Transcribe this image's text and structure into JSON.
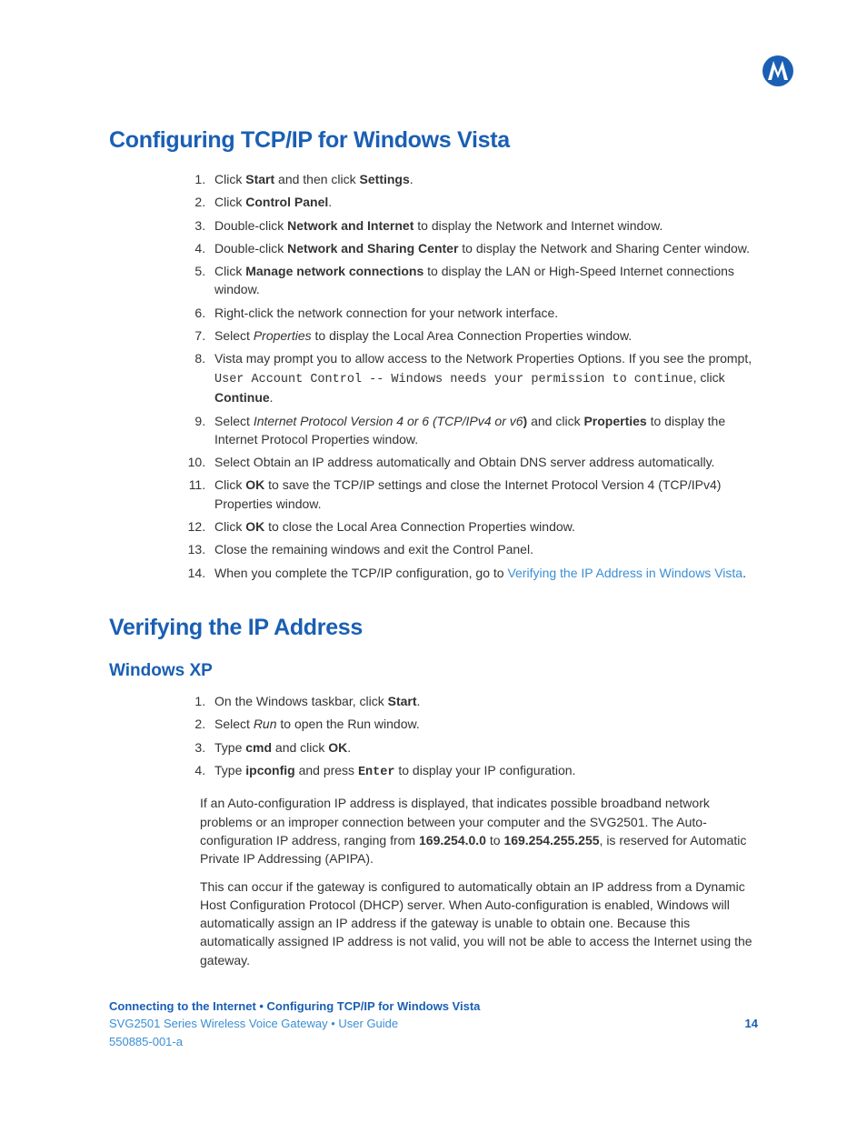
{
  "logo_name": "motorola-logo",
  "section1": {
    "title": "Configuring TCP/IP for Windows Vista",
    "steps": [
      {
        "pre": "Click ",
        "bold1": "Start",
        "mid": " and then click ",
        "bold2": "Settings",
        "post": "."
      },
      {
        "pre": "Click ",
        "bold1": "Control Panel",
        "post": "."
      },
      {
        "pre": "Double-click ",
        "bold1": "Network and Internet",
        "post": " to display the Network and Internet window."
      },
      {
        "pre": "Double-click ",
        "bold1": "Network and Sharing Center",
        "post": " to display the Network and Sharing Center window."
      },
      {
        "pre": "Click ",
        "bold1": "Manage network connections",
        "post": " to display the LAN or High-Speed Internet connections window."
      },
      {
        "plain": "Right-click the network connection for your network interface."
      },
      {
        "pre": "Select ",
        "italic": "Properties",
        "post": " to display the Local Area Connection Properties window."
      },
      {
        "pre": "Vista may prompt you to allow access to the Network Properties Options. If you see the prompt, ",
        "mono": "User Account Control -- Windows needs your permission to continue",
        "mid": ", click ",
        "bold1": "Continue",
        "post": "."
      },
      {
        "pre": "Select ",
        "italic": "Internet Protocol Version 4 or 6 (TCP/IPv4 or v6",
        "boldparen": ")",
        "mid": " and click ",
        "bold1": "Properties",
        "post": " to display the Internet Protocol Properties window."
      },
      {
        "plain": "Select Obtain an IP address automatically and Obtain DNS server address automatically."
      },
      {
        "pre": "Click ",
        "bold1": "OK",
        "post": " to save the TCP/IP settings and close the Internet Protocol Version 4 (TCP/IPv4) Properties window."
      },
      {
        "pre": "Click ",
        "bold1": "OK",
        "post": " to close the Local Area Connection Properties window."
      },
      {
        "plain": "Close the remaining windows and exit the Control Panel."
      },
      {
        "pre": "When you complete the TCP/IP configuration, go to ",
        "link": "Verifying the IP Address in Windows Vista",
        "post": "."
      }
    ]
  },
  "section2": {
    "title": "Verifying the IP Address",
    "subtitle": "Windows XP",
    "steps": [
      {
        "pre": "On the Windows taskbar, click ",
        "bold1": "Start",
        "post": "."
      },
      {
        "pre": "Select ",
        "italic": "Run",
        "post": " to open the Run window."
      },
      {
        "pre": "Type ",
        "bold1": "cmd",
        "mid": " and click ",
        "bold2": "OK",
        "post": "."
      },
      {
        "pre": "Type ",
        "bold1": "ipconfig",
        "mid": " and press ",
        "monobold": "Enter",
        "post": " to display your IP configuration."
      }
    ],
    "para1": {
      "p1": "If an Auto-configuration IP address is displayed, that indicates possible broadband network problems or an improper connection between your computer and the SVG2501. The Auto-configuration IP address, ranging from ",
      "b1": "169.254.0.0",
      "p2": " to ",
      "b2": "169.254.255.255",
      "p3": ", is reserved for Automatic Private IP Addressing (APIPA)."
    },
    "para2": "This can occur if the gateway is configured to automatically obtain an IP address from a Dynamic Host Configuration Protocol (DHCP) server. When Auto-configuration is enabled, Windows will automatically assign an IP address if the gateway is unable to obtain one. Because this automatically assigned IP address is not valid, you will not be able to access the Internet using the gateway."
  },
  "footer": {
    "breadcrumb": "Connecting to the Internet • Configuring TCP/IP for Windows Vista",
    "guide": "SVG2501 Series Wireless Voice Gateway • User Guide",
    "pagenum": "14",
    "docnum": "550885-001-a"
  }
}
